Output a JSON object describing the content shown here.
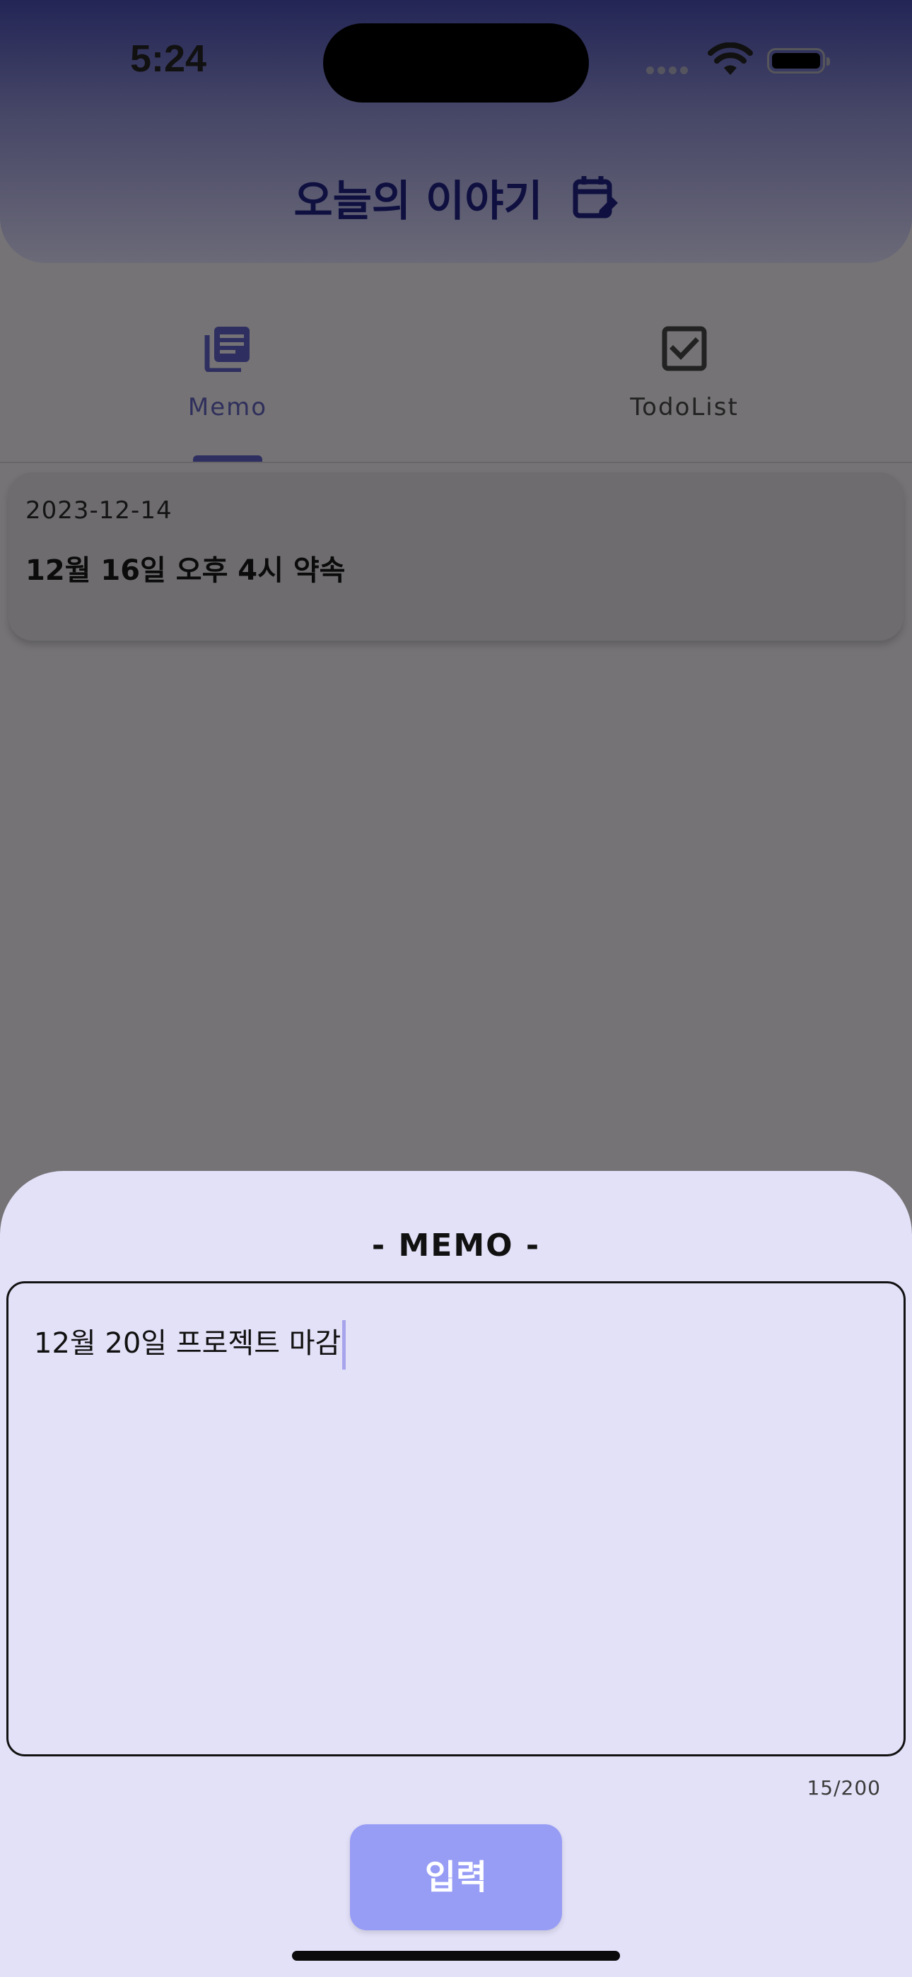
{
  "status_bar": {
    "time": "5:24"
  },
  "header": {
    "title": "오늘의 이야기",
    "title_icon": "calendar-edit-icon"
  },
  "tabs": [
    {
      "label": "Memo",
      "icon": "notes-icon",
      "selected": true
    },
    {
      "label": "TodoList",
      "icon": "checkbox-icon",
      "selected": false
    }
  ],
  "memos": [
    {
      "date": "2023-12-14",
      "title": "12월 16일 오후 4시 약속"
    }
  ],
  "sheet": {
    "title": "- MEMO -",
    "input_value": "12월 20일 프로젝트 마감",
    "counter": "15/200",
    "submit_label": "입력"
  },
  "colors": {
    "accent": "#2e2f60",
    "sheet_bg": "#e3e1f8",
    "button": "#979cf5",
    "overlay_bg": "#757375"
  }
}
